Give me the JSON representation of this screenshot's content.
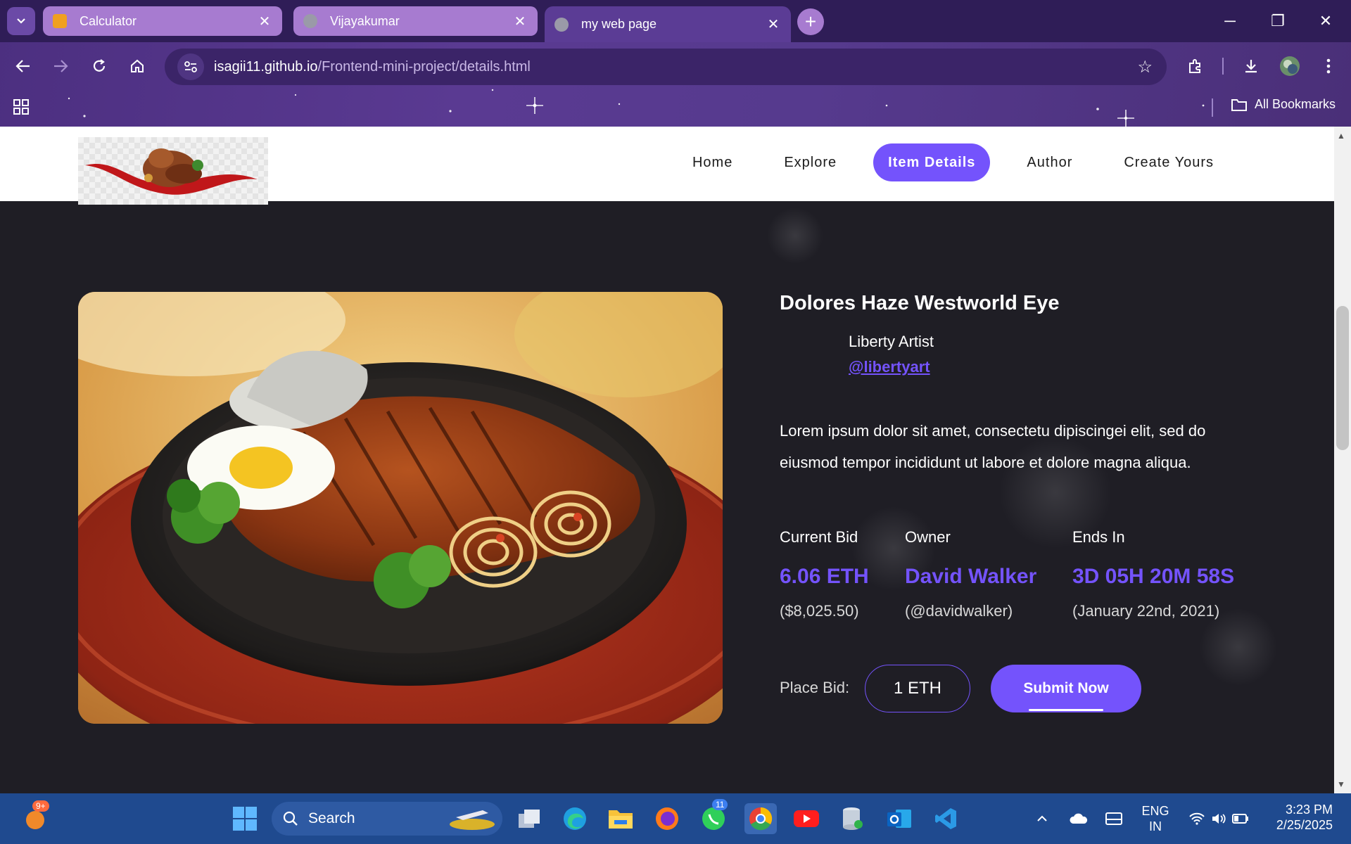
{
  "browser": {
    "tabs": [
      {
        "label": "Calculator",
        "state": "inactive",
        "favicon_color": "#f0a020"
      },
      {
        "label": "Vijayakumar",
        "state": "inactive",
        "favicon_color": "#9a9aa8"
      },
      {
        "label": "my web page",
        "state": "active",
        "favicon_color": "#9a9aa8"
      }
    ],
    "url_host": "isagii11.github.io",
    "url_path": "/Frontend-mini-project/details.html",
    "all_bookmarks_label": "All Bookmarks"
  },
  "site": {
    "nav": [
      {
        "label": "Home",
        "active": false
      },
      {
        "label": "Explore",
        "active": false
      },
      {
        "label": "Item Details",
        "active": true
      },
      {
        "label": "Author",
        "active": false
      },
      {
        "label": "Create Yours",
        "active": false
      }
    ],
    "item": {
      "title": "Dolores Haze Westworld Eye",
      "author_name": "Liberty Artist",
      "author_handle": "@libertyart",
      "description": "Lorem ipsum dolor sit amet, consectetu dipiscingei elit, sed do eiusmod tempor incididunt ut labore et dolore magna aliqua.",
      "stats": [
        {
          "label": "Current Bid",
          "value": "6.06 ETH",
          "sub": "($8,025.50)"
        },
        {
          "label": "Owner",
          "value": "David Walker",
          "sub": "(@davidwalker)"
        },
        {
          "label": "Ends In",
          "value": "3D 05H 20M 58S",
          "sub": "(January 22nd, 2021)"
        }
      ],
      "bid_label": "Place Bid:",
      "bid_value": "1 ETH",
      "submit_label": "Submit Now"
    },
    "accent_color": "#7453fc"
  },
  "taskbar": {
    "search_placeholder": "Search",
    "notification_badge": "9+",
    "whatsapp_badge": "11",
    "language": "ENG",
    "region": "IN",
    "time": "3:23 PM",
    "date": "2/25/2025"
  }
}
